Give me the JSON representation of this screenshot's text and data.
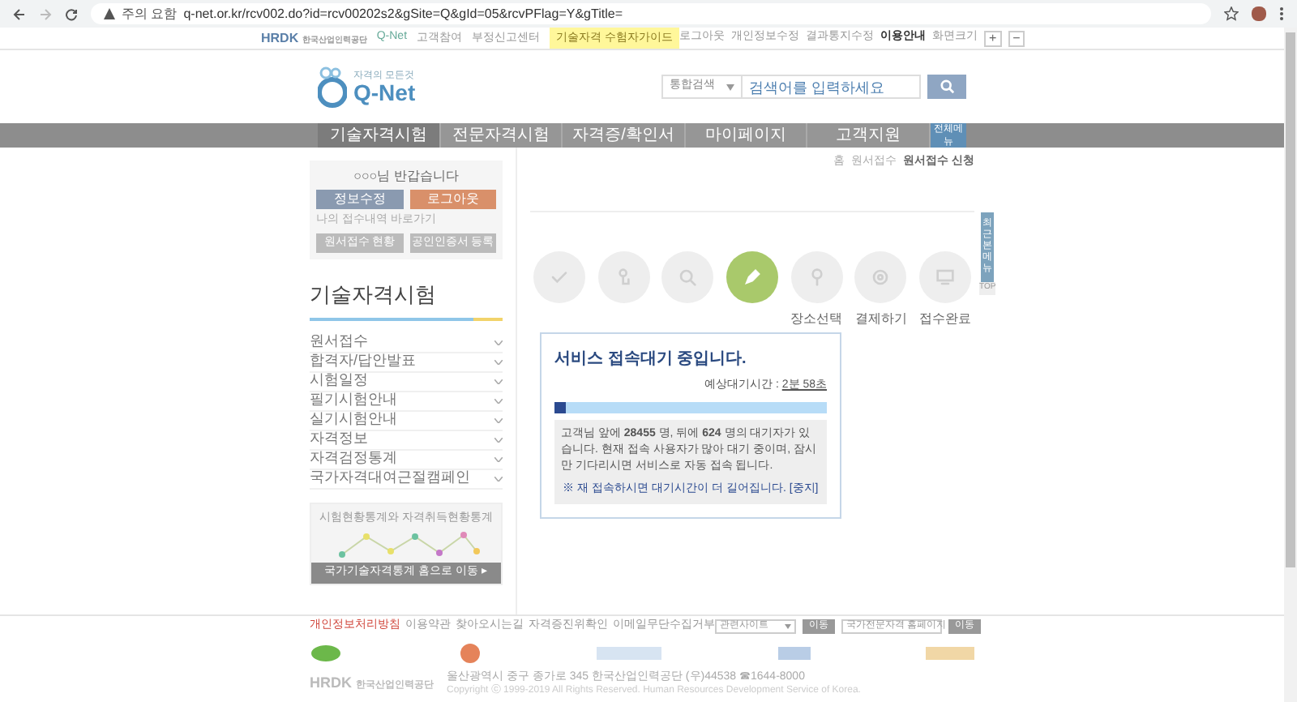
{
  "browser": {
    "security": "주의 요함",
    "url": "q-net.or.kr/rcv002.do?id=rcv00202s2&gSite=Q&gId=05&rcvPFlag=Y&gTitle="
  },
  "util_bar": {
    "left": [
      {
        "label": "고객참여",
        "highlight": false
      },
      {
        "label": "부정신고센터",
        "highlight": false
      },
      {
        "label": "기술자격 수험자가이드",
        "highlight": true
      }
    ],
    "right": [
      {
        "label": "로그아웃",
        "bold": false
      },
      {
        "label": "개인정보수정",
        "bold": false
      },
      {
        "label": "결과통지수정",
        "bold": false
      },
      {
        "label": "이용안내",
        "bold": true
      },
      {
        "label": "화면크기",
        "bold": false
      }
    ],
    "zoom_in": "+",
    "zoom_out": "−",
    "hrdk": "HRDK",
    "hrdk_sub": "한국산업인력공단",
    "qnet_small": "Q-Net"
  },
  "header": {
    "logo_small": "자격의 모든것",
    "logo": "Q-Net",
    "search_select": "통합검색",
    "search_placeholder": "검색어를 입력하세요"
  },
  "nav": {
    "items": [
      {
        "label": "기술자격시험",
        "selected": true
      },
      {
        "label": "전문자격시험",
        "selected": false
      },
      {
        "label": "자격증/확인서",
        "selected": false
      },
      {
        "label": "마이페이지",
        "selected": false
      },
      {
        "label": "고객지원",
        "selected": false
      }
    ],
    "all_menu": "전체메뉴"
  },
  "breadcrumb": [
    "홈",
    "원서접수",
    "원서접수 신청"
  ],
  "login_box": {
    "greeting": "○○○님 반갑습니다",
    "edit": "정보수정",
    "logout": "로그아웃",
    "my_link": "나의 접수내역 바로가기",
    "status": "원서접수 현황",
    "cert": "공인인증서 등록"
  },
  "sidebar": {
    "title": "기술자격시험",
    "items": [
      "원서접수",
      "합격자/답안발표",
      "시험일정",
      "필기시험안내",
      "실기시험안내",
      "자격정보",
      "자격검정통계",
      "국가자격대여근절캠페인"
    ],
    "stats_title": "시험현황통계와 자격취득현황통계",
    "stats_button": "국가기술자격통계 홈으로 이동 ▸"
  },
  "steps": [
    {
      "kind": "check",
      "selected": false
    },
    {
      "kind": "touch",
      "selected": false
    },
    {
      "kind": "search",
      "selected": false
    },
    {
      "kind": "pencil",
      "selected": true
    },
    {
      "kind": "pin",
      "label": "장소선택",
      "selected": false
    },
    {
      "kind": "pay",
      "label": "결제하기",
      "selected": false
    },
    {
      "kind": "monitor",
      "label": "접수완료",
      "selected": false
    }
  ],
  "wait_dialog": {
    "title": "서비스 접속대기 중입니다.",
    "time_label": "예상대기시간 :",
    "time": "2분 58초",
    "level": 0.04,
    "message": "고객님 앞에 **28455** 명, 뒤에 **624** 명의 대기자가 있습니다. 현재 접속 사용자가 많아 대기 중이며, 잠시만 기다리시면 서비스로 자동 접속 됩니다.",
    "note": "※ 재 접속하시면 대기시간이 더 길어집니다.",
    "stop": "[중지]"
  },
  "side_tab": {
    "label": "최근본메뉴",
    "top": "TOP"
  },
  "footer": {
    "links": [
      {
        "label": "개인정보처리방침",
        "red": true
      },
      {
        "label": "이용약관",
        "red": false
      },
      {
        "label": "찾아오시는길",
        "red": false
      },
      {
        "label": "자격증진위확인",
        "red": false
      },
      {
        "label": "이메일무단수집거부",
        "red": false
      }
    ],
    "site_select": "관련사이트",
    "go1": "이동",
    "site_select2": "국가전문자격 홈페이지",
    "go2": "이동",
    "hrdk": "HRDK",
    "org": "한국산업인력공단",
    "address": "울산광역시 중구 종가로 345 한국산업인력공단 (우)44538 ☎1644-8000",
    "copyright": "Copyright ⓒ 1999-2019 All Rights Reserved. Human Resources Development Service of Korea."
  }
}
